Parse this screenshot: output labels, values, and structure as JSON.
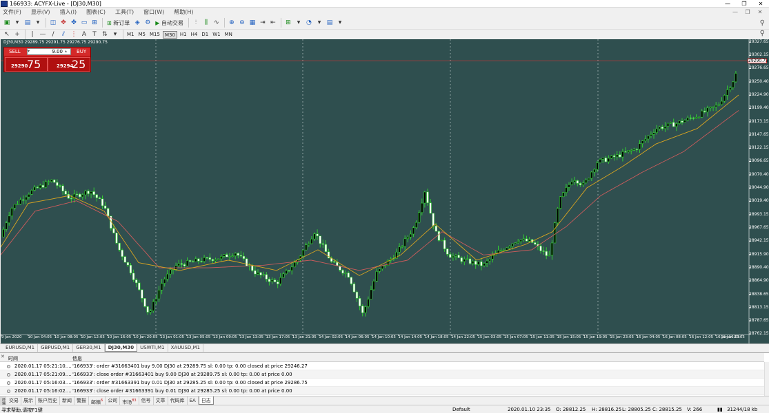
{
  "window": {
    "title": "166933: ACYFX-Live - [DJ30,M30]",
    "btn_min": "—",
    "btn_max": "❐",
    "btn_close": "✕"
  },
  "menu": [
    "文件(F)",
    "显示(V)",
    "插入(I)",
    "图表(C)",
    "工具(T)",
    "窗口(W)",
    "帮助(H)"
  ],
  "mdi_buttons": [
    "—",
    "❐",
    "✕"
  ],
  "toolbar": {
    "new_order": "新订单",
    "auto_trade": "自动交易"
  },
  "timeframes": [
    "M1",
    "M5",
    "M15",
    "M30",
    "H1",
    "H4",
    "D1",
    "W1",
    "MN"
  ],
  "active_timeframe": "M30",
  "chart": {
    "header": "DJ30,M30  29289.75 29291.75 29276.75 29290.75",
    "price_labels": [
      "29327.65",
      "29302.15",
      "29276.65",
      "29250.40",
      "29224.90",
      "29199.40",
      "29173.15",
      "29147.65",
      "29122.15",
      "29096.65",
      "29070.40",
      "29044.90",
      "29019.40",
      "28993.15",
      "28967.65",
      "28942.15",
      "28915.90",
      "28890.40",
      "28864.90",
      "28838.65",
      "28813.15",
      "28787.65",
      "28762.15"
    ],
    "current_price": "29290.75",
    "time_labels": [
      "9 Jan 2020",
      "10 Jan 04:05",
      "10 Jan 08:05",
      "10 Jan 12:05",
      "10 Jan 16:05",
      "10 Jan 20:05",
      "13 Jan 01:05",
      "13 Jan 05:05",
      "13 Jan 09:05",
      "13 Jan 13:05",
      "13 Jan 17:05",
      "13 Jan 21:05",
      "14 Jan 02:05",
      "14 Jan 06:05",
      "14 Jan 10:05",
      "14 Jan 14:05",
      "14 Jan 18:05",
      "14 Jan 22:05",
      "15 Jan 03:05",
      "15 Jan 07:05",
      "15 Jan 11:05",
      "15 Jan 15:05",
      "15 Jan 19:05",
      "15 Jan 23:05",
      "16 Jan 04:05",
      "16 Jan 08:05",
      "16 Jan 12:05",
      "16 Jan 16:05",
      "16 Jan 20:05"
    ]
  },
  "one_click": {
    "sell_label": "SELL",
    "buy_label": "BUY",
    "lots": "9.00",
    "sell_small": "29290",
    "sell_big": "75",
    "buy_small": "29294",
    "buy_big": "25"
  },
  "symbol_tabs": [
    "EURUSD,M1",
    "GBPUSD,M1",
    "GER30,M1",
    "DJ30,M30",
    "USWTI,M1",
    "XAUUSD,M1"
  ],
  "active_symbol_tab": "DJ30,M30",
  "terminal": {
    "col_time": "时间",
    "col_msg": "信息",
    "rows": [
      {
        "time": "2020.01.17 05:21:10....",
        "msg": "'166933': order #31663401 buy 9.00 DJ30 at 29289.75 sl: 0.00 tp: 0.00 closed at price 29246.27"
      },
      {
        "time": "2020.01.17 05:21:09....",
        "msg": "'166933': close order #31663401 buy 9.00 DJ30 at 29289.75 sl: 0.00 tp: 0.00 at price 0.00"
      },
      {
        "time": "2020.01.17 05:16:03....",
        "msg": "'166933': order #31663391 buy 0.01 DJ30 at 29285.25 sl: 0.00 tp: 0.00 closed at price 29286.75"
      },
      {
        "time": "2020.01.17 05:16:02....",
        "msg": "'166933': close order #31663391 buy 0.01 DJ30 at 29285.25 sl: 0.00 tp: 0.00 at price 0.00"
      }
    ],
    "side_label": "终端",
    "tabs": [
      {
        "label": "交易",
        "badge": ""
      },
      {
        "label": "展示",
        "badge": ""
      },
      {
        "label": "账户历史",
        "badge": ""
      },
      {
        "label": "新闻",
        "badge": ""
      },
      {
        "label": "警报",
        "badge": ""
      },
      {
        "label": "邮箱",
        "badge": "6"
      },
      {
        "label": "公司",
        "badge": ""
      },
      {
        "label": "市场",
        "badge": "83"
      },
      {
        "label": "信号",
        "badge": ""
      },
      {
        "label": "文章",
        "badge": ""
      },
      {
        "label": "代码库",
        "badge": ""
      },
      {
        "label": "EA",
        "badge": ""
      },
      {
        "label": "日志",
        "badge": ""
      }
    ],
    "active_tab": "日志"
  },
  "status": {
    "help": "寻求帮助,请按F1键",
    "profile": "Default",
    "datetime": "2020.01.10 23:35",
    "open": "O: 28812.25",
    "high": "H: 28816.25",
    "low": "L: 28805.25",
    "close": "C: 28815.25",
    "volume": "V: 266",
    "traffic": "31244/18 kb"
  },
  "colors": {
    "chart_bg": "#2f4f4f",
    "candle": "#32cd32",
    "ma_fast": "#daa520",
    "ma_slow": "#cd5c5c",
    "sell": "#c01818"
  },
  "chart_data": {
    "type": "candlestick",
    "symbol": "DJ30",
    "timeframe": "M30",
    "y_range": [
      28762.15,
      29327.65
    ],
    "close_path": [
      [
        0,
        28950
      ],
      [
        15,
        29005
      ],
      [
        40,
        29035
      ],
      [
        75,
        29060
      ],
      [
        100,
        29025
      ],
      [
        130,
        29040
      ],
      [
        150,
        29010
      ],
      [
        170,
        28930
      ],
      [
        190,
        28880
      ],
      [
        215,
        28800
      ],
      [
        235,
        28865
      ],
      [
        255,
        28895
      ],
      [
        290,
        28905
      ],
      [
        320,
        28910
      ],
      [
        340,
        28920
      ],
      [
        370,
        28880
      ],
      [
        400,
        28860
      ],
      [
        430,
        28905
      ],
      [
        455,
        28960
      ],
      [
        480,
        28900
      ],
      [
        505,
        28875
      ],
      [
        525,
        28800
      ],
      [
        545,
        28880
      ],
      [
        575,
        28920
      ],
      [
        600,
        28970
      ],
      [
        615,
        29040
      ],
      [
        630,
        28960
      ],
      [
        650,
        28915
      ],
      [
        670,
        28905
      ],
      [
        700,
        28895
      ],
      [
        720,
        28920
      ],
      [
        750,
        28945
      ],
      [
        770,
        28940
      ],
      [
        795,
        28910
      ],
      [
        810,
        29020
      ],
      [
        830,
        29065
      ],
      [
        845,
        29050
      ],
      [
        865,
        29095
      ],
      [
        890,
        29105
      ],
      [
        920,
        29120
      ],
      [
        950,
        29160
      ],
      [
        980,
        29170
      ],
      [
        1010,
        29185
      ],
      [
        1040,
        29205
      ],
      [
        1065,
        29260
      ],
      [
        1070,
        29290
      ]
    ],
    "ma_fast_path": [
      [
        0,
        28930
      ],
      [
        40,
        29015
      ],
      [
        100,
        29030
      ],
      [
        150,
        29000
      ],
      [
        200,
        28900
      ],
      [
        260,
        28885
      ],
      [
        330,
        28905
      ],
      [
        400,
        28885
      ],
      [
        460,
        28925
      ],
      [
        520,
        28875
      ],
      [
        580,
        28915
      ],
      [
        630,
        28975
      ],
      [
        690,
        28905
      ],
      [
        760,
        28935
      ],
      [
        800,
        28960
      ],
      [
        850,
        29045
      ],
      [
        900,
        29085
      ],
      [
        950,
        29130
      ],
      [
        1010,
        29160
      ],
      [
        1070,
        29225
      ]
    ],
    "ma_slow_path": [
      [
        0,
        28915
      ],
      [
        50,
        29000
      ],
      [
        110,
        29020
      ],
      [
        170,
        28980
      ],
      [
        230,
        28890
      ],
      [
        300,
        28890
      ],
      [
        380,
        28895
      ],
      [
        450,
        28905
      ],
      [
        520,
        28885
      ],
      [
        590,
        28905
      ],
      [
        640,
        28960
      ],
      [
        700,
        28915
      ],
      [
        770,
        28925
      ],
      [
        820,
        28970
      ],
      [
        870,
        29030
      ],
      [
        930,
        29075
      ],
      [
        990,
        29115
      ],
      [
        1070,
        29195
      ]
    ]
  }
}
